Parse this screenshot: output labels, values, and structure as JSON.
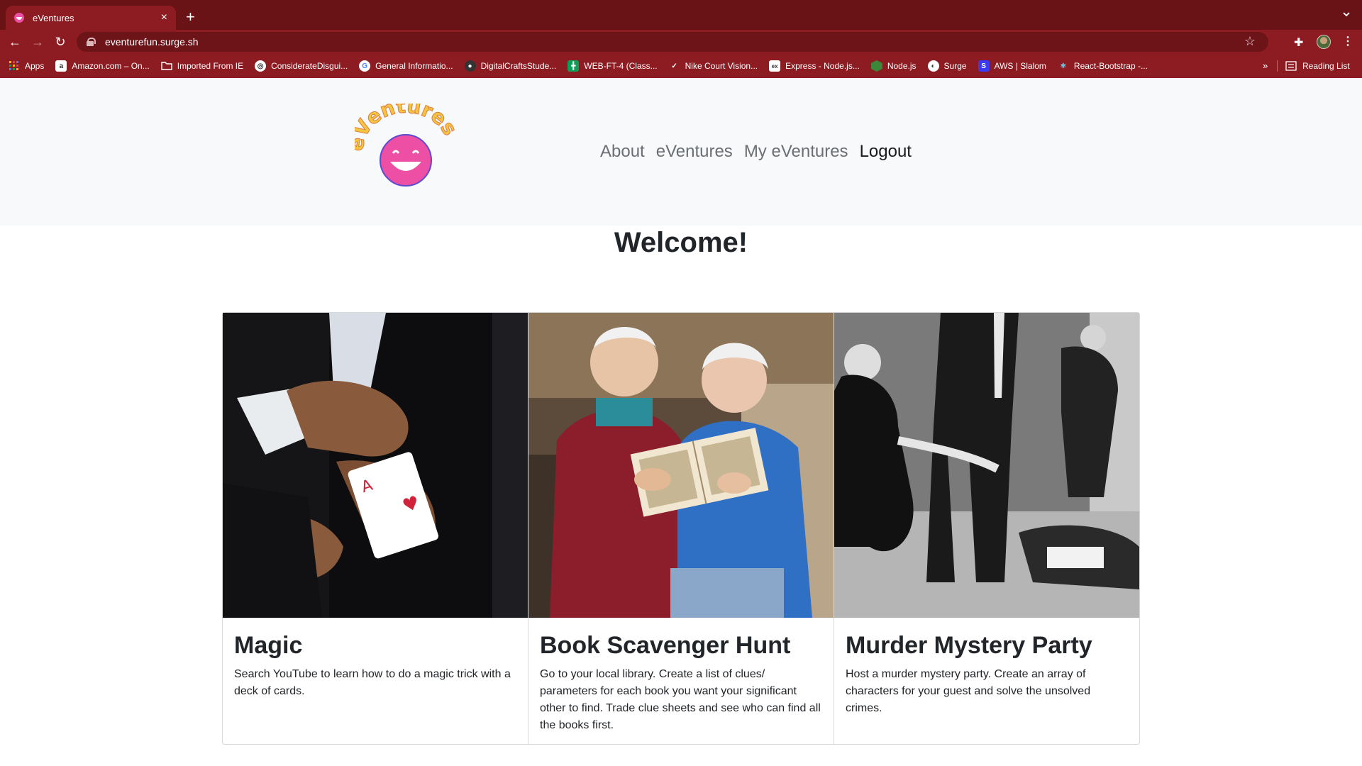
{
  "browser": {
    "tab_title": "eVentures",
    "url": "eventurefun.surge.sh",
    "bookmarks": [
      {
        "label": "Apps",
        "icon": "apps-grid-icon",
        "color": "#f4b400"
      },
      {
        "label": "Amazon.com – On...",
        "icon": "amazon-icon",
        "color": "#ffffff"
      },
      {
        "label": "Imported From IE",
        "icon": "folder-icon",
        "color": "#e0e0e0"
      },
      {
        "label": "ConsiderateDisgui...",
        "icon": "replit-icon",
        "color": "#ffffff"
      },
      {
        "label": "General Informatio...",
        "icon": "google-icon",
        "color": "#ffffff"
      },
      {
        "label": "DigitalCraftsStude...",
        "icon": "github-icon",
        "color": "#333333"
      },
      {
        "label": "WEB-FT-4 (Class...",
        "icon": "sheets-icon",
        "color": "#0f9d58"
      },
      {
        "label": "Nike Court Vision...",
        "icon": "nike-icon",
        "color": "#8d1b22"
      },
      {
        "label": "Express - Node.js...",
        "icon": "express-icon",
        "color": "#ffffff"
      },
      {
        "label": "Node.js",
        "icon": "nodejs-icon",
        "color": "#3c873a"
      },
      {
        "label": "Surge",
        "icon": "surge-icon",
        "color": "#ffffff"
      },
      {
        "label": "AWS | Slalom",
        "icon": "slalom-icon",
        "color": "#3a3af5"
      },
      {
        "label": "React-Bootstrap -...",
        "icon": "react-bootstrap-icon",
        "color": "#61dafb"
      }
    ],
    "more_label": "»",
    "reading_list": "Reading List"
  },
  "header": {
    "logo_text": "eVentures",
    "nav": [
      "About",
      "eVentures",
      "My eVentures",
      "Logout"
    ]
  },
  "main": {
    "heading": "Welcome!",
    "cards": [
      {
        "title": "Magic",
        "text": "Search YouTube to learn how to do a magic trick with a deck of cards."
      },
      {
        "title": "Book Scavenger Hunt",
        "text": "Go to your local library. Create a list of clues/ parameters for each book you want your significant other to find. Trade clue sheets and see who can find all the books first."
      },
      {
        "title": "Murder Mystery Party",
        "text": "Host a murder mystery party. Create an array of characters for your guest and solve the unsolved crimes."
      }
    ]
  },
  "colors": {
    "browser_dark": "#6a1317",
    "browser_mid": "#8d1b22",
    "header_bg": "#f8f9fa",
    "logo_face": "#ec4fa3",
    "logo_text": "#f4c542"
  }
}
